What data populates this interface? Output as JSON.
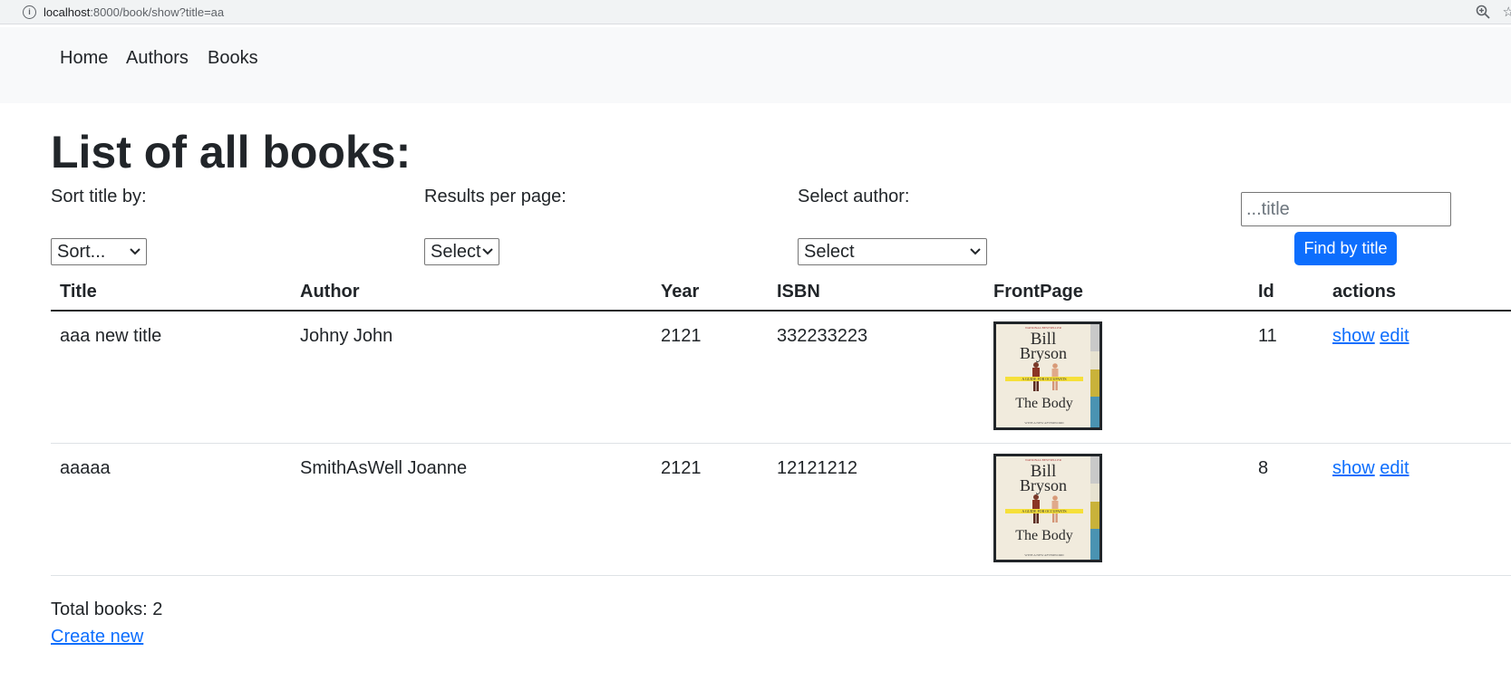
{
  "browser": {
    "url_host": "localhost",
    "url_rest": ":8000/book/show?title=aa"
  },
  "nav": {
    "items": [
      "Home",
      "Authors",
      "Books"
    ]
  },
  "page": {
    "title": "List of all books:"
  },
  "filters": {
    "sort_label": "Sort title by:",
    "sort_value": "Sort...",
    "per_page_label": "Results per page:",
    "per_page_value": "Select",
    "author_label": "Select author:",
    "author_value": "Select",
    "title_placeholder": "...title",
    "find_button": "Find by title"
  },
  "table": {
    "headers": [
      "Title",
      "Author",
      "Year",
      "ISBN",
      "FrontPage",
      "Id",
      "actions"
    ],
    "rows": [
      {
        "title": "aaa new title",
        "author": "Johny John",
        "year": "2121",
        "isbn": "332233223",
        "id": "11",
        "show": "show",
        "edit": "edit"
      },
      {
        "title": "aaaaa",
        "author": "SmithAsWell Joanne",
        "year": "2121",
        "isbn": "12121212",
        "id": "8",
        "show": "show",
        "edit": "edit"
      }
    ]
  },
  "cover": {
    "top_line": "NATIONAL BESTSELLER",
    "author_first": "Bill",
    "author_last": "Bryson",
    "subtitle": "A GUIDE FOR OCCUPANTS",
    "title": "The Body",
    "bottom_line": "WITH A NEW AFTERWORD"
  },
  "footer": {
    "total": "Total books: 2",
    "create_link": "Create new"
  },
  "colors": {
    "accent": "#0d6efd",
    "navbar_bg": "#f8f9fa",
    "text": "#212529"
  }
}
